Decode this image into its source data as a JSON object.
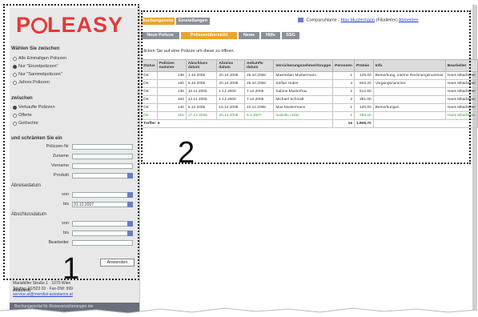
{
  "logo": {
    "text_left": "P",
    "text_right": "LEASY"
  },
  "left": {
    "section1": "Wählen Sie zwischen",
    "filter1": [
      {
        "label": "Alle Einmaligen Polizzen",
        "on": false
      },
      {
        "label": "Nur \"Einzelpolizzen\"",
        "on": true
      },
      {
        "label": "Nur \"Sammelpolizzen\"",
        "on": false
      },
      {
        "label": "Jahres Polizzen",
        "on": false
      }
    ],
    "section2": "zwischen",
    "filter2": [
      {
        "label": "Verkaufte Polizzen",
        "on": true
      },
      {
        "label": "Offerte",
        "on": false
      },
      {
        "label": "Gelöschte",
        "on": false
      }
    ],
    "section3": "und schränken Sie ein",
    "fields": {
      "polizzen_nr": "Polizzen-Nr",
      "zuname": "Zuname",
      "vorname": "Vorname",
      "produkt": "Produkt",
      "abreisedatum": "Abreisedatum",
      "von": "von",
      "bis": "bis",
      "bis_value": "31.12.2007",
      "abschlussdatum": "Abschlussdatum",
      "von2": "von",
      "bis2": "bis",
      "bearbeiter": "Bearbeiter"
    },
    "apply_label": "Anwenden",
    "footer_l1": "Anschrift",
    "footer_l2": "Mariahilfer Straße 1 · 1070 Wien",
    "footer_l3": "Telefon: 01/523 03 · Fax-DW: 999",
    "footer_l4": "service.at@mondial-assistance.at",
    "footer_bar": "Buchungsportal für Reiseversicherungen der"
  },
  "top_tabs": [
    "Buchungsseite",
    "Einstellungen"
  ],
  "sub_tabs": [
    "Neue Polizze",
    "Polizzenübersicht",
    "News",
    "Hilfe",
    "SSG"
  ],
  "company": {
    "name": "CompanyName -",
    "user": "Max Mustermann",
    "role": "(Filialleiter)",
    "logout": "Abmelden"
  },
  "hint": "Klicken Sie auf eine Polizze um diese zu öffnen.",
  "table": {
    "headers": [
      "Status",
      "Polizzen nummer",
      "Abschluss datum",
      "Abreise datum",
      "Ankunfts datum",
      "Versicherungsnehmer/Gruppe",
      "Personen",
      "Prämie",
      "Info",
      "Bearbeiter"
    ],
    "rows": [
      [
        "OK",
        "138",
        "1.10.2006",
        "20.10.2006",
        "25.10.2006",
        "Maximilian Mustermann",
        "1",
        "125.00",
        "Bemerkung, interne Rechnungsnummer",
        "Hans Mitarbeiter"
      ],
      [
        "OK",
        "165",
        "5.10.2006",
        "20.10.2006",
        "25.10.2006",
        "Stefan Huber",
        "4",
        "503.20",
        "Vorgangsnummer",
        "Hans Mitarbeiter"
      ],
      [
        "OK",
        "136",
        "10.11.2006",
        "1.12.2006",
        "7.12.2006",
        "Sabine Musterfrau",
        "2",
        "512.60",
        "",
        "Hans Mitarbeiter"
      ],
      [
        "OK",
        "163",
        "14.11.2006",
        "1.12.2006",
        "7.12.2006",
        "Michael Schmidt",
        "3",
        "351.00",
        "",
        "Hans Mitarbeiter"
      ],
      [
        "OK",
        "146",
        "6.12.2006",
        "15.12.2006",
        "22.12.2006",
        "Max Mustermann",
        "1",
        "120.00",
        "Bemerkungen",
        "Hans Mitarbeiter"
      ],
      [
        "OK",
        "151",
        "17.12.2006",
        "26.12.2006",
        "6.1.2007",
        "Isabelle Hofer",
        "5",
        "396.50",
        "",
        "Hans Mitarbeiter"
      ]
    ],
    "green_row": 5,
    "sum_label": "Treffer: 6",
    "sum_persons": "16",
    "sum_premium": "1.808,70"
  },
  "callouts": [
    "1",
    "2"
  ]
}
